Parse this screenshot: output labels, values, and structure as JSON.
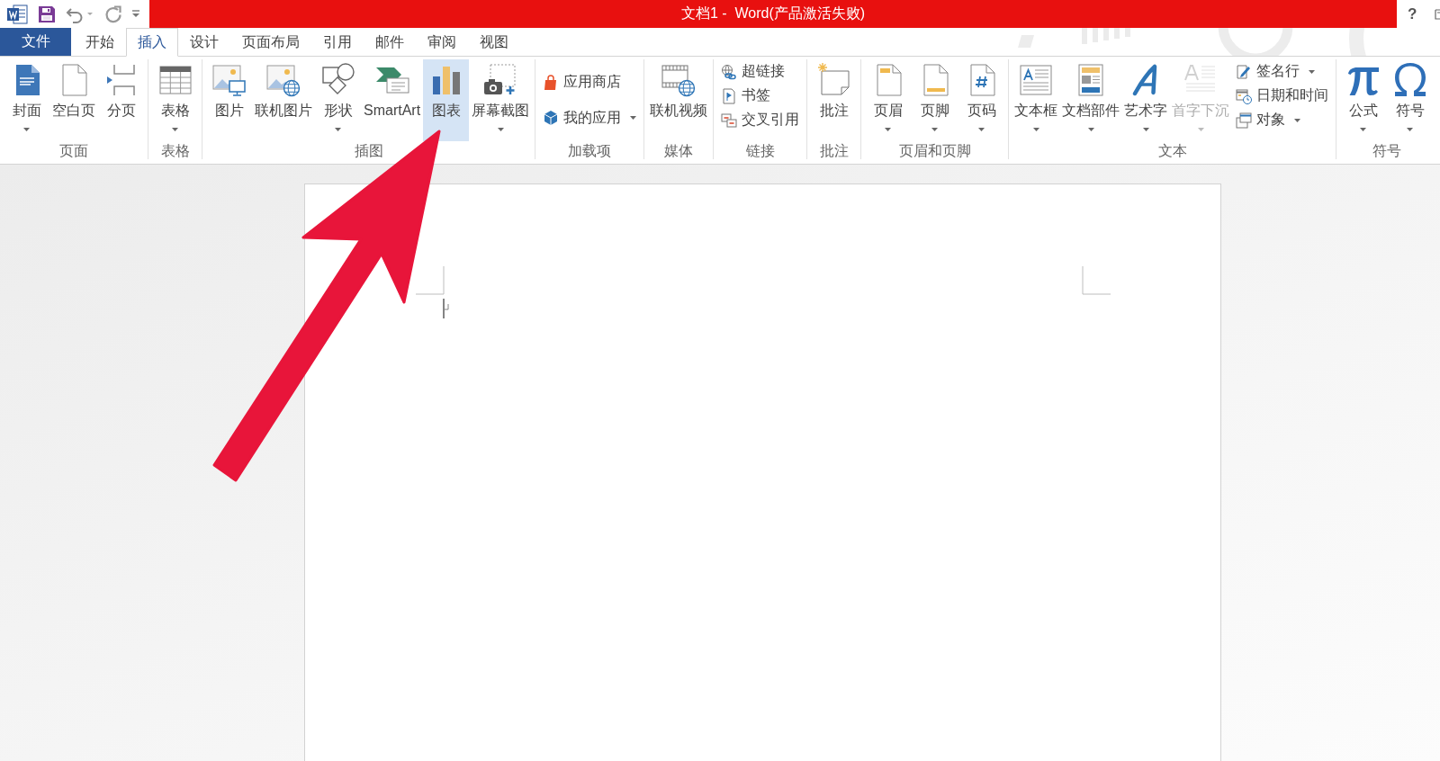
{
  "window": {
    "title": "文档1 -  Word(产品激活失败)",
    "help": "?"
  },
  "tabs": [
    {
      "label": "文件",
      "kind": "file",
      "selected": false
    },
    {
      "label": "开始",
      "kind": "tab",
      "selected": false
    },
    {
      "label": "插入",
      "kind": "tab",
      "selected": true
    },
    {
      "label": "设计",
      "kind": "tab",
      "selected": false
    },
    {
      "label": "页面布局",
      "kind": "tab",
      "selected": false
    },
    {
      "label": "引用",
      "kind": "tab",
      "selected": false
    },
    {
      "label": "邮件",
      "kind": "tab",
      "selected": false
    },
    {
      "label": "审阅",
      "kind": "tab",
      "selected": false
    },
    {
      "label": "视图",
      "kind": "tab",
      "selected": false
    }
  ],
  "ribbon": {
    "groups": [
      {
        "label": "页面",
        "items": [
          {
            "kind": "large",
            "label": "封面",
            "dropdown": true,
            "disabled": false,
            "highlighted": false
          },
          {
            "kind": "large",
            "label": "空白页",
            "dropdown": false,
            "disabled": false,
            "highlighted": false
          },
          {
            "kind": "large",
            "label": "分页",
            "dropdown": false,
            "disabled": false,
            "highlighted": false
          }
        ]
      },
      {
        "label": "表格",
        "items": [
          {
            "kind": "large",
            "label": "表格",
            "dropdown": true,
            "disabled": false,
            "highlighted": false
          }
        ]
      },
      {
        "label": "插图",
        "items": [
          {
            "kind": "large",
            "label": "图片",
            "dropdown": false,
            "disabled": false,
            "highlighted": false
          },
          {
            "kind": "large",
            "label": "联机图片",
            "dropdown": false,
            "disabled": false,
            "highlighted": false
          },
          {
            "kind": "large",
            "label": "形状",
            "dropdown": true,
            "disabled": false,
            "highlighted": false
          },
          {
            "kind": "large",
            "label": "SmartArt",
            "dropdown": false,
            "disabled": false,
            "highlighted": false
          },
          {
            "kind": "large",
            "label": "图表",
            "dropdown": false,
            "disabled": false,
            "highlighted": true
          },
          {
            "kind": "large",
            "label": "屏幕截图",
            "dropdown": true,
            "disabled": false,
            "highlighted": false
          }
        ]
      },
      {
        "label": "加载项",
        "items": [
          {
            "kind": "small",
            "label": "应用商店",
            "dropdown": false,
            "disabled": false,
            "highlighted": false
          },
          {
            "kind": "small",
            "label": "我的应用",
            "dropdown": true,
            "disabled": false,
            "highlighted": false
          }
        ]
      },
      {
        "label": "媒体",
        "items": [
          {
            "kind": "large",
            "label": "联机视频",
            "dropdown": false,
            "disabled": false,
            "highlighted": false
          }
        ]
      },
      {
        "label": "链接",
        "items": [
          {
            "kind": "small",
            "label": "超链接",
            "dropdown": false,
            "disabled": false,
            "highlighted": false
          },
          {
            "kind": "small",
            "label": "书签",
            "dropdown": false,
            "disabled": false,
            "highlighted": false
          },
          {
            "kind": "small",
            "label": "交叉引用",
            "dropdown": false,
            "disabled": false,
            "highlighted": false
          }
        ]
      },
      {
        "label": "批注",
        "items": [
          {
            "kind": "large",
            "label": "批注",
            "dropdown": false,
            "disabled": false,
            "highlighted": false
          }
        ]
      },
      {
        "label": "页眉和页脚",
        "items": [
          {
            "kind": "large",
            "label": "页眉",
            "dropdown": true,
            "disabled": false,
            "highlighted": false
          },
          {
            "kind": "large",
            "label": "页脚",
            "dropdown": true,
            "disabled": false,
            "highlighted": false
          },
          {
            "kind": "large",
            "label": "页码",
            "dropdown": true,
            "disabled": false,
            "highlighted": false
          }
        ]
      },
      {
        "label": "文本",
        "items": [
          {
            "kind": "large",
            "label": "文本框",
            "dropdown": true,
            "disabled": false,
            "highlighted": false
          },
          {
            "kind": "large",
            "label": "文档部件",
            "dropdown": true,
            "disabled": false,
            "highlighted": false
          },
          {
            "kind": "large",
            "label": "艺术字",
            "dropdown": true,
            "disabled": false,
            "highlighted": false
          },
          {
            "kind": "large",
            "label": "首字下沉",
            "dropdown": true,
            "disabled": true,
            "highlighted": false
          },
          {
            "kind": "small",
            "label": "签名行",
            "dropdown": true,
            "disabled": false,
            "highlighted": false
          },
          {
            "kind": "small",
            "label": "日期和时间",
            "dropdown": false,
            "disabled": false,
            "highlighted": false
          },
          {
            "kind": "small",
            "label": "对象",
            "dropdown": true,
            "disabled": false,
            "highlighted": false
          }
        ]
      },
      {
        "label": "符号",
        "items": [
          {
            "kind": "large",
            "label": "公式",
            "dropdown": true,
            "disabled": false,
            "highlighted": false
          },
          {
            "kind": "large",
            "label": "符号",
            "dropdown": true,
            "disabled": false,
            "highlighted": false
          }
        ]
      }
    ]
  }
}
